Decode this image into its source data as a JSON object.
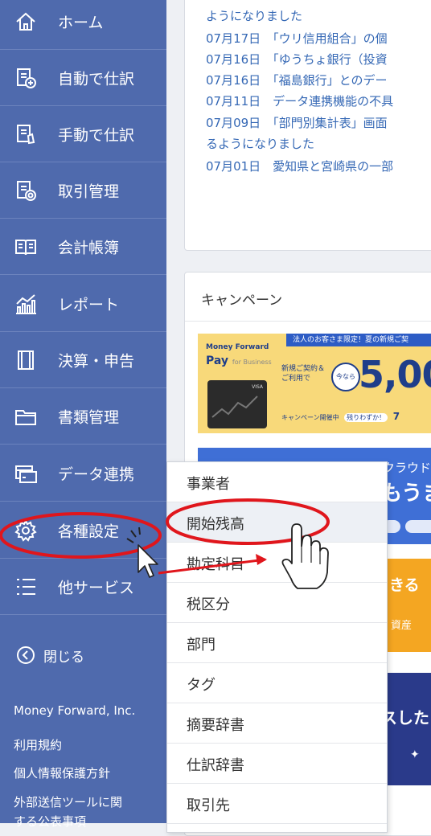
{
  "sidebar": {
    "items": [
      {
        "label": "ホーム",
        "icon": "home-icon"
      },
      {
        "label": "自動で仕訳",
        "icon": "auto-journal-icon"
      },
      {
        "label": "手動で仕訳",
        "icon": "manual-journal-icon"
      },
      {
        "label": "取引管理",
        "icon": "transaction-icon"
      },
      {
        "label": "会計帳簿",
        "icon": "ledger-book-icon"
      },
      {
        "label": "レポート",
        "icon": "report-chart-icon"
      },
      {
        "label": "決算・申告",
        "icon": "settlement-icon"
      },
      {
        "label": "書類管理",
        "icon": "folder-icon"
      },
      {
        "label": "データ連携",
        "icon": "data-link-icon"
      },
      {
        "label": "各種設定",
        "icon": "gear-icon"
      },
      {
        "label": "他サービス",
        "icon": "list-icon"
      }
    ],
    "close_label": "閉じる",
    "company": "Money Forward, Inc.",
    "links": [
      "利用規約",
      "個人情報保護方針",
      "外部送信ツールに関",
      "する公表事項"
    ]
  },
  "news": {
    "lines": [
      "ようになりました",
      "07月17日　「ウリ信用組合」の個",
      "07月16日　「ゆうちょ銀行（投資",
      "07月16日　「福島銀行」とのデー",
      "07月11日　データ連携機能の不具",
      "07月09日　「部門別集計表」画面",
      "るようになりました",
      "07月01日　愛知県と宮崎県の一部"
    ]
  },
  "campaign": {
    "title": "キャンペーン",
    "banner1": {
      "brand": "Money Forward",
      "product": "Pay",
      "product_sub": "for Business",
      "headline": "法人のお客さま限定！夏の新規ご契",
      "sub": "新規ご契約＆ご利用で",
      "badge": "今なら",
      "amount": "5,00",
      "period": "キャンペーン開催中",
      "period_tag": "残りわずか！",
      "period_num": "7",
      "card": "VISA"
    },
    "banner2": {
      "top": "クラウド",
      "big": "もうま"
    },
    "banner3": {
      "top": "きる",
      "bottom": "資産"
    },
    "banner4": {
      "text": "スした"
    }
  },
  "submenu": {
    "items": [
      "事業者",
      "開始残高",
      "勘定科目",
      "税区分",
      "部門",
      "タグ",
      "摘要辞書",
      "仕訳辞書",
      "取引先"
    ]
  },
  "colors": {
    "sidebar": "#4f6aad",
    "link": "#3568b5",
    "annotation": "#e0161c"
  }
}
